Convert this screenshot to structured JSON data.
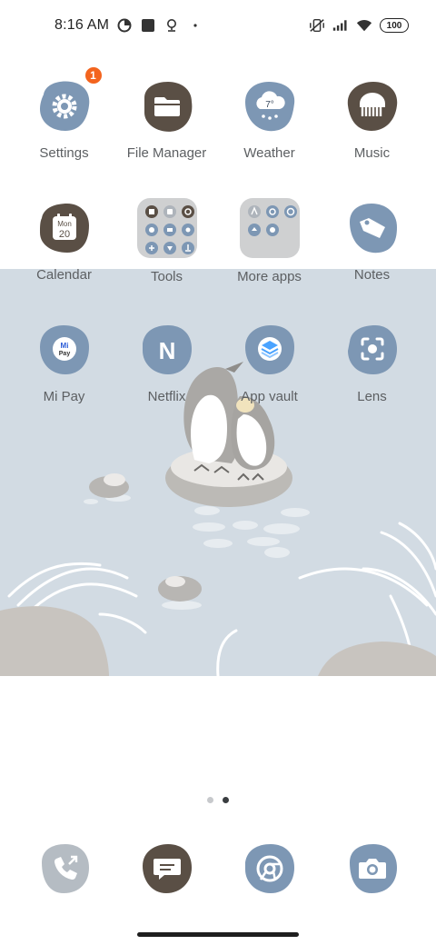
{
  "status_bar": {
    "time": "8:16 AM",
    "left_icons": [
      "data-saver-icon",
      "square-notification-icon",
      "location-icon",
      "dot-icon"
    ],
    "right_icons": [
      "vibrate-mute-icon",
      "signal-icon",
      "wifi-icon"
    ],
    "battery": "100"
  },
  "apps": [
    {
      "label": "Settings",
      "icon": "gear-icon",
      "badge": "1"
    },
    {
      "label": "File Manager",
      "icon": "folder-icon"
    },
    {
      "label": "Weather",
      "icon": "cloud-rain-icon",
      "temp": "7°"
    },
    {
      "label": "Music",
      "icon": "music-icon"
    },
    {
      "label": "Calendar",
      "icon": "calendar-icon",
      "day": "Mon",
      "date": "20"
    },
    {
      "label": "Tools",
      "icon": "folder-tools-icon"
    },
    {
      "label": "More apps",
      "icon": "folder-apps-icon"
    },
    {
      "label": "Notes",
      "icon": "tag-icon"
    },
    {
      "label": "Mi Pay",
      "icon": "mi-pay-icon",
      "icon_text_1": "Mi",
      "icon_text_2": "Pay"
    },
    {
      "label": "Netflix",
      "icon": "netflix-icon",
      "icon_text": "N"
    },
    {
      "label": "App vault",
      "icon": "layers-icon"
    },
    {
      "label": "Lens",
      "icon": "lens-icon"
    }
  ],
  "page_indicator": {
    "pages": 2,
    "current": 2
  },
  "dock": [
    {
      "icon": "phone-icon"
    },
    {
      "icon": "message-icon"
    },
    {
      "icon": "chrome-icon"
    },
    {
      "icon": "camera-icon"
    }
  ],
  "colors": {
    "blue_blob": "#7d97b4",
    "brown_blob": "#5a4f45",
    "gray_blob": "#b5bcc3",
    "wallpaper_sky": "#d2dbe3",
    "badge": "#f3641e"
  }
}
